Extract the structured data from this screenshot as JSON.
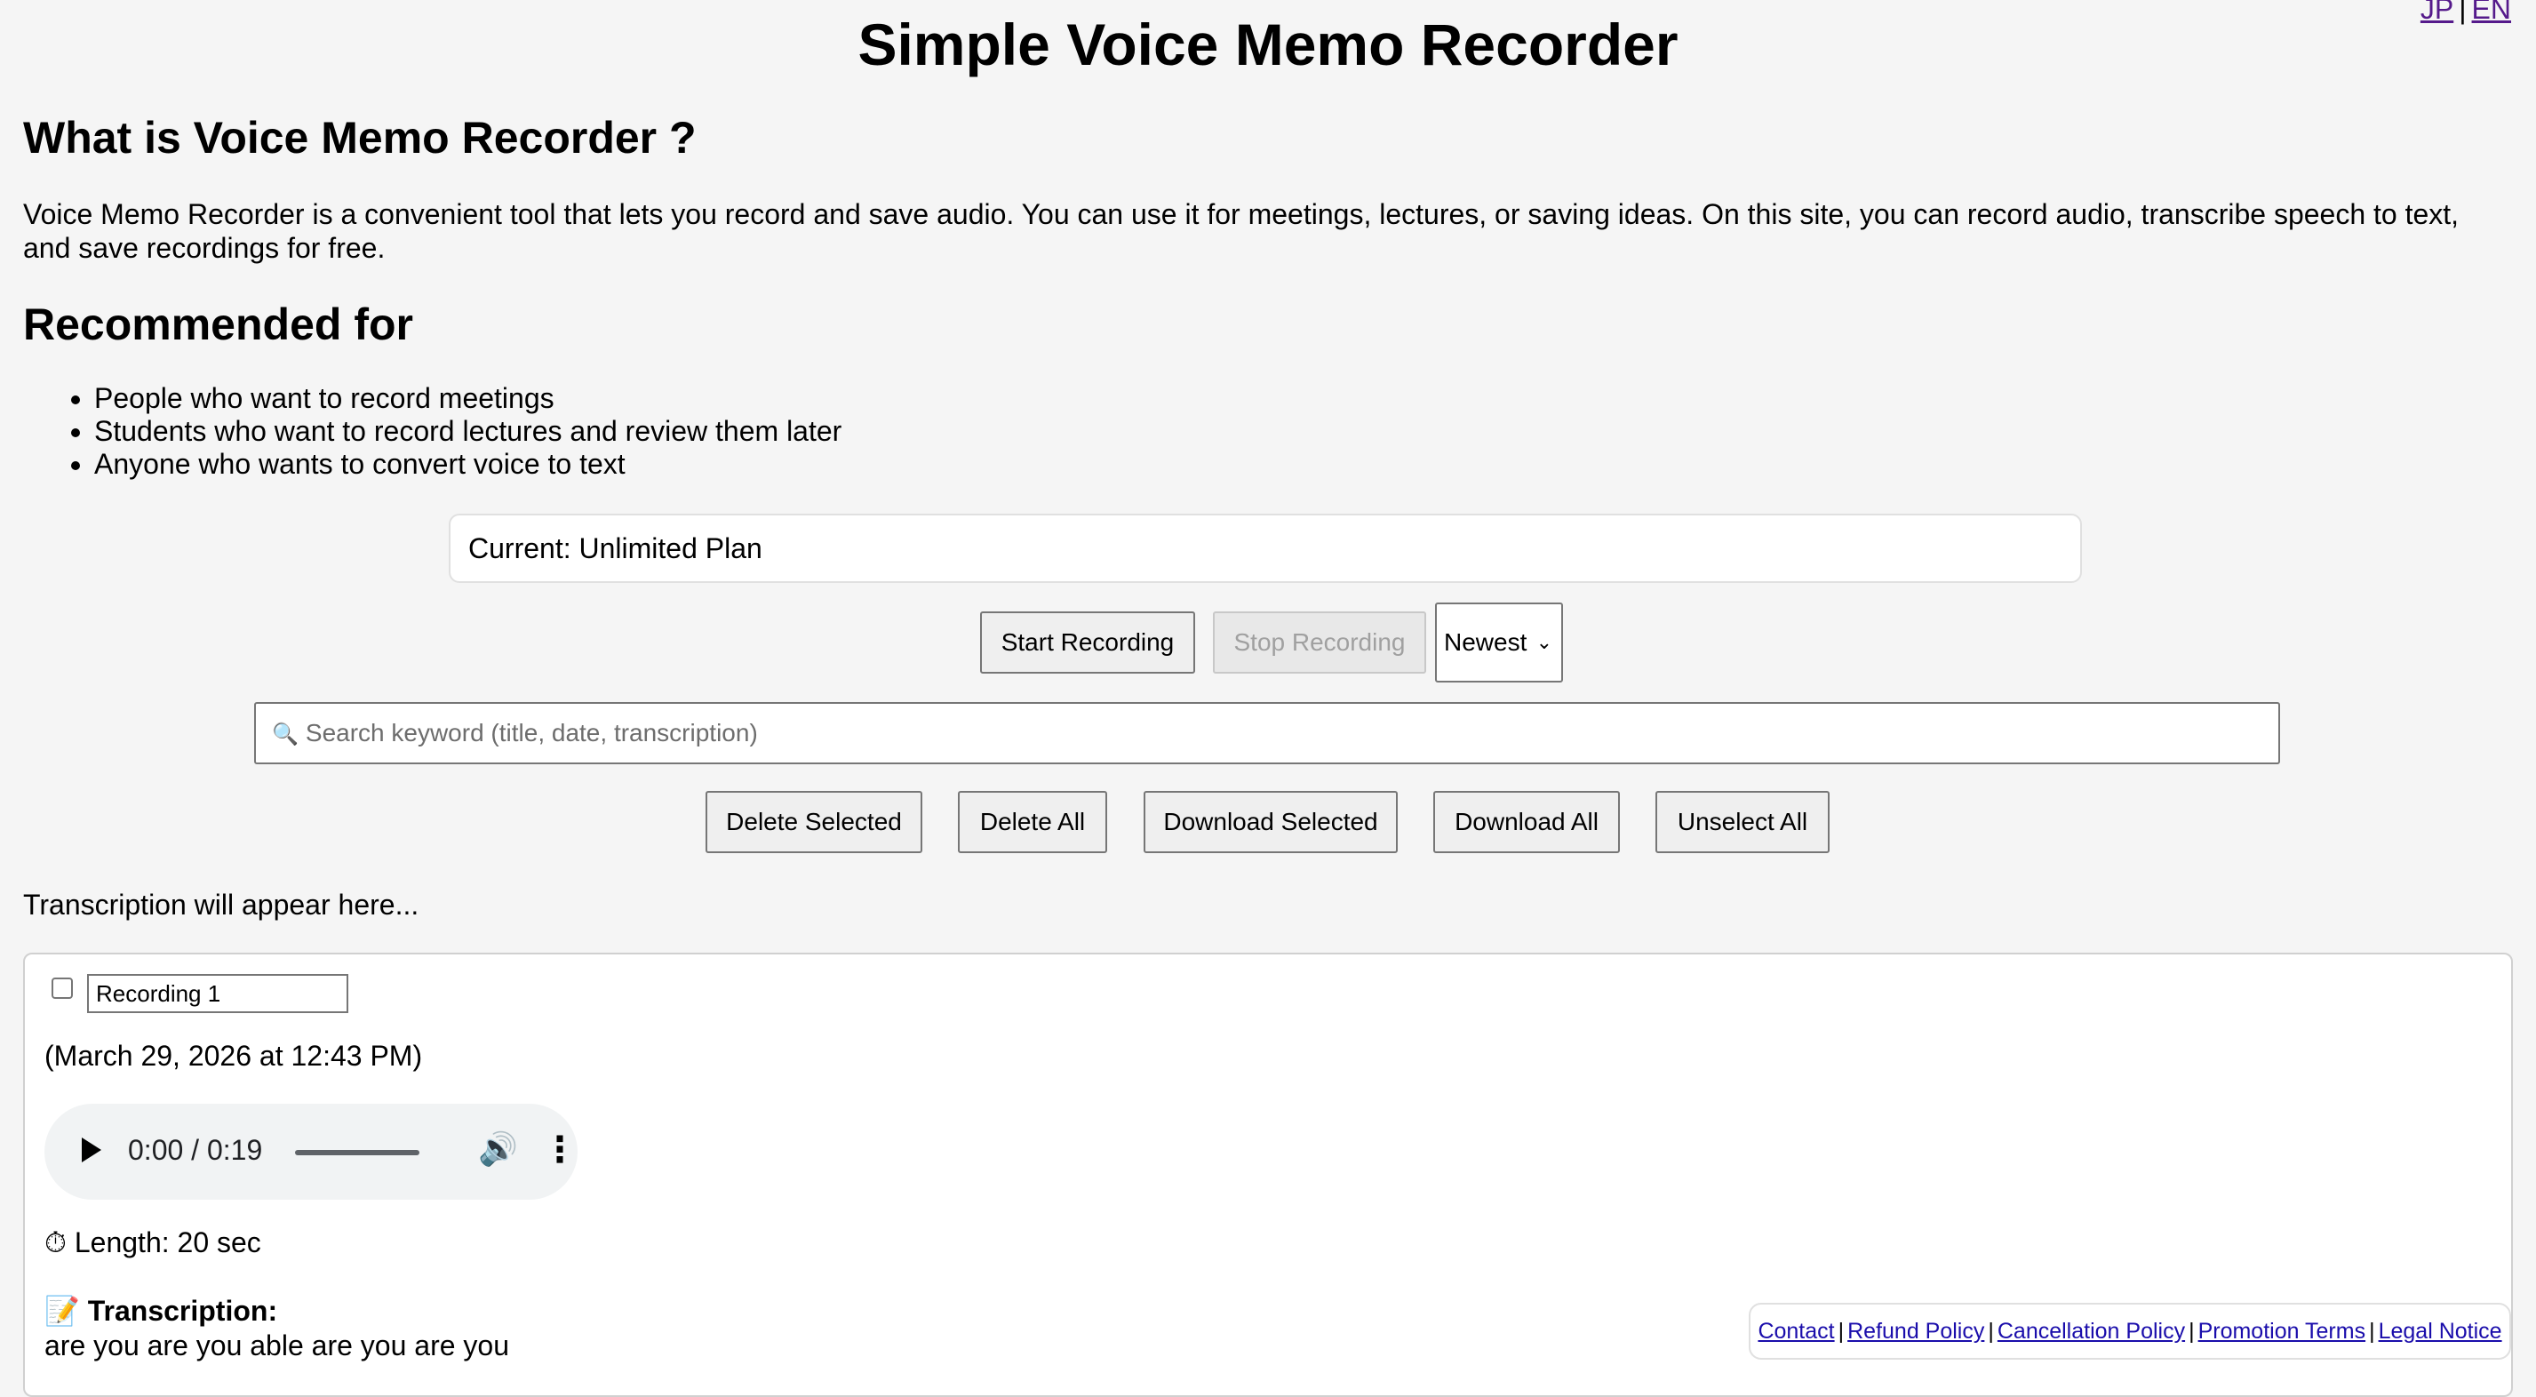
{
  "lang": {
    "jp": "JP",
    "sep": "|",
    "en": "EN"
  },
  "title": "Simple Voice Memo Recorder",
  "intro": {
    "heading": "What is Voice Memo Recorder ?",
    "text": "Voice Memo Recorder is a convenient tool that lets you record and save audio. You can use it for meetings, lectures, or saving ideas. On this site, you can record audio, transcribe speech to text, and save recordings for free."
  },
  "recommended": {
    "heading": "Recommended for",
    "items": [
      "People who want to record meetings",
      "Students who want to record lectures and review them later",
      "Anyone who wants to convert voice to text"
    ]
  },
  "plan": {
    "current": "Current: Unlimited Plan"
  },
  "controls": {
    "start": "Start Recording",
    "stop": "Stop Recording",
    "sort_selected": "Newest"
  },
  "search": {
    "placeholder": "Search keyword (title, date, transcription)"
  },
  "actions": {
    "delete_selected": "Delete Selected",
    "delete_all": "Delete All",
    "download_selected": "Download Selected",
    "download_all": "Download All",
    "unselect_all": "Unselect All"
  },
  "transcription_placeholder": "Transcription will appear here...",
  "recordings": [
    {
      "title": "Recording 1",
      "date": "(March 29, 2026 at 12:43 PM)",
      "player_time": "0:00 / 0:19",
      "length": "Length: 20 sec",
      "transcription_label": "Transcription:",
      "transcription": "are you are you able are you are you"
    }
  ],
  "footer": {
    "contact": "Contact",
    "refund": "Refund Policy",
    "cancellation": "Cancellation Policy",
    "promotion": "Promotion Terms",
    "legal": "Legal Notice",
    "sep": "|"
  }
}
